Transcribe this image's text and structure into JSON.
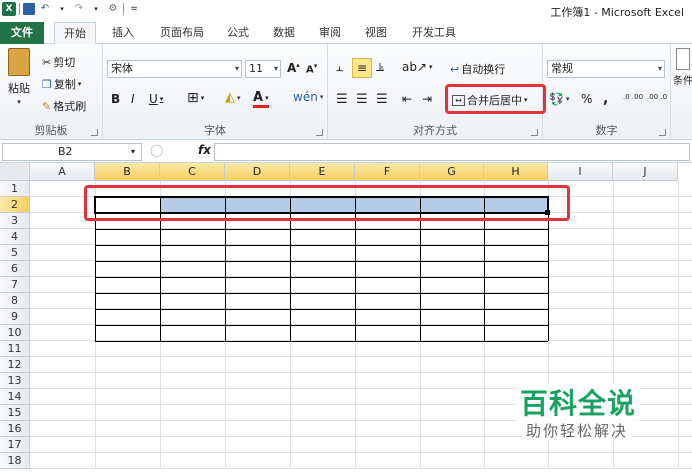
{
  "window": {
    "title": "工作簿1 - Microsoft Excel"
  },
  "tabs": [
    "文件",
    "开始",
    "插入",
    "页面布局",
    "公式",
    "数据",
    "审阅",
    "视图",
    "开发工具"
  ],
  "clipboard": {
    "paste": "粘贴",
    "cut": "剪切",
    "copy": "复制",
    "format_painter": "格式刷",
    "label": "剪贴板"
  },
  "font": {
    "name": "宋体",
    "size": "11",
    "label": "字体",
    "bold": "B",
    "italic": "I",
    "underline": "U"
  },
  "alignment": {
    "wrap_text": "自动换行",
    "merge_center": "合并后居中",
    "label": "对齐方式"
  },
  "number": {
    "format": "常规",
    "percent": "%",
    "comma": ",",
    "label": "数字",
    "inc_dec": ".0 .00",
    "dec_dec": ".00 .0"
  },
  "styles": {
    "conditional": "条件"
  },
  "formula_bar": {
    "name_box": "B2",
    "fx": "fx",
    "value": ""
  },
  "sheet": {
    "columns": [
      "A",
      "B",
      "C",
      "D",
      "E",
      "F",
      "G",
      "H",
      "I",
      "J"
    ],
    "rows": [
      "1",
      "2",
      "3",
      "4",
      "5",
      "6",
      "7",
      "8",
      "9",
      "10",
      "11",
      "12",
      "13",
      "14",
      "15",
      "16",
      "17",
      "18"
    ],
    "selected_columns": [
      "B",
      "C",
      "D",
      "E",
      "F",
      "G",
      "H"
    ],
    "selected_row": "2"
  },
  "watermark": {
    "title": "百科全说",
    "subtitle": "助你轻松解决"
  },
  "colors": {
    "file_tab": "#217346",
    "highlight": "#e0343a",
    "selection": "#b4cbe7",
    "watermark": "#1aa260"
  }
}
